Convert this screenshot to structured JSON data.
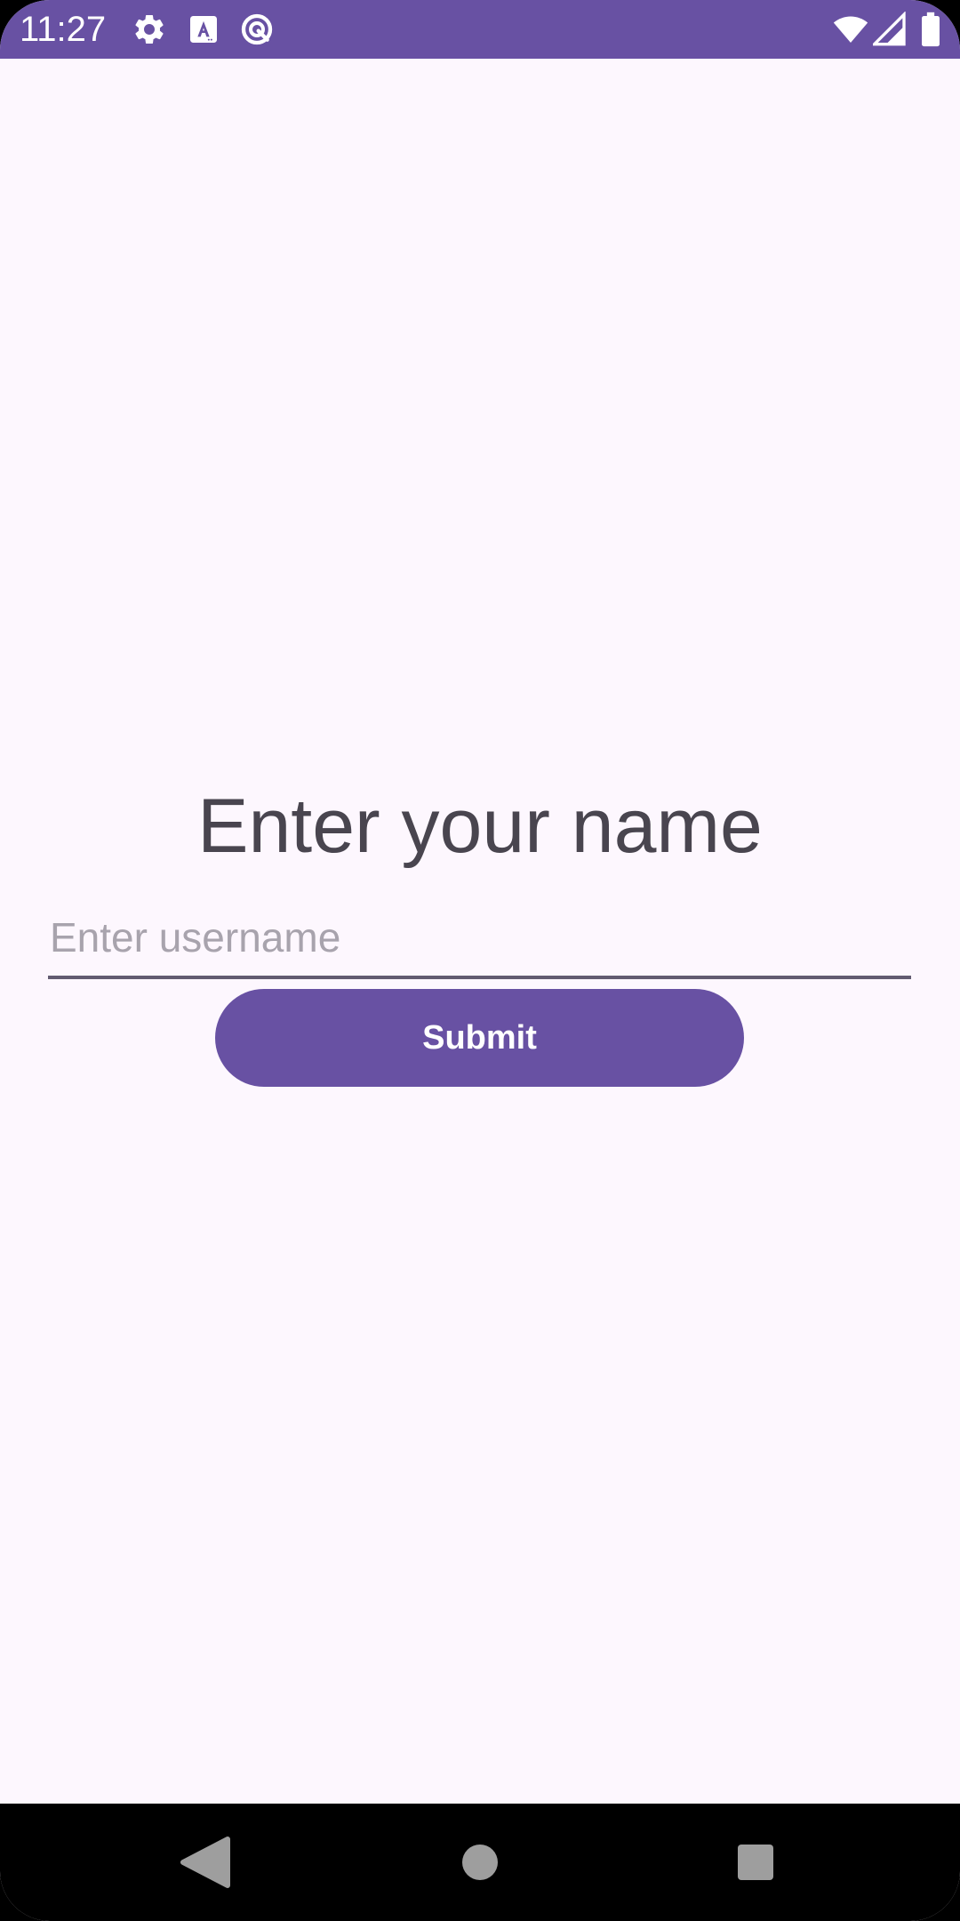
{
  "status_bar": {
    "time": "11:27",
    "icons": [
      "gear-icon",
      "text-a-icon",
      "vpn-ring-icon",
      "wifi-icon",
      "cell-signal-icon",
      "battery-icon"
    ],
    "background_color": "#6851a3"
  },
  "main": {
    "title": "Enter your name",
    "username_input": {
      "placeholder": "Enter username",
      "value": ""
    },
    "submit_label": "Submit",
    "accent_color": "#6851a3"
  },
  "nav_bar": {
    "buttons": [
      "back-icon",
      "home-icon",
      "recents-icon"
    ]
  }
}
